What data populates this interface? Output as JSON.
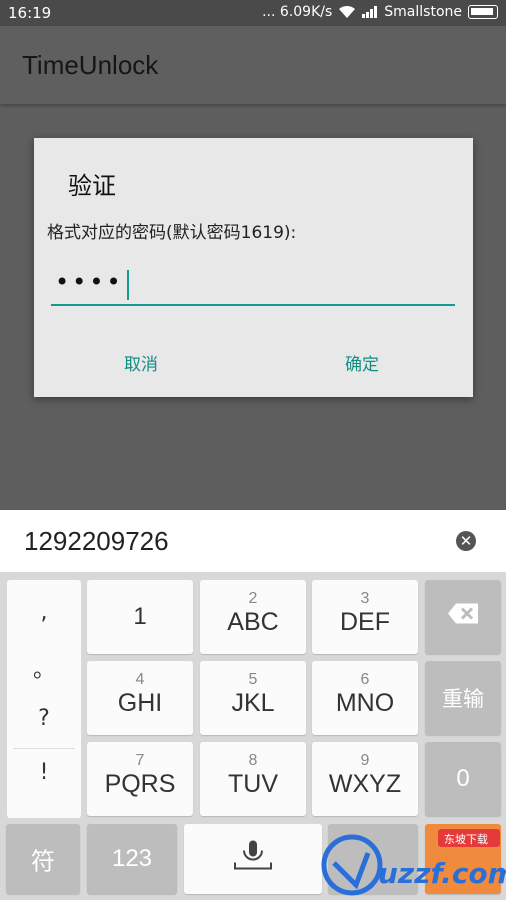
{
  "status_bar": {
    "time": "16:19",
    "network": "... 6.09K/s",
    "carrier": "Smallstone"
  },
  "app_bar": {
    "title": "TimeUnlock"
  },
  "dialog": {
    "title": "验证",
    "message": "格式对应的密码(默认密码1619):",
    "password_mask": "••••",
    "cancel_label": "取消",
    "ok_label": "确定"
  },
  "input_bar": {
    "value": "1292209726"
  },
  "keyboard": {
    "symbols": [
      ",",
      "。",
      "?",
      "!"
    ],
    "keys": [
      {
        "digit": "1",
        "letters": ""
      },
      {
        "digit": "2",
        "letters": "ABC"
      },
      {
        "digit": "3",
        "letters": "DEF"
      },
      {
        "digit": "4",
        "letters": "GHI"
      },
      {
        "digit": "5",
        "letters": "JKL"
      },
      {
        "digit": "6",
        "letters": "MNO"
      },
      {
        "digit": "7",
        "letters": "PQRS"
      },
      {
        "digit": "8",
        "letters": "TUV"
      },
      {
        "digit": "9",
        "letters": "WXYZ"
      }
    ],
    "reenter_label": "重输",
    "zero_label": "0",
    "symbol_key_label": "符",
    "num_key_label": "123"
  },
  "watermark": {
    "text": "uzzf.com",
    "subtext": "东坡下载"
  },
  "colors": {
    "accent": "#129990",
    "button_text": "#128d84"
  }
}
